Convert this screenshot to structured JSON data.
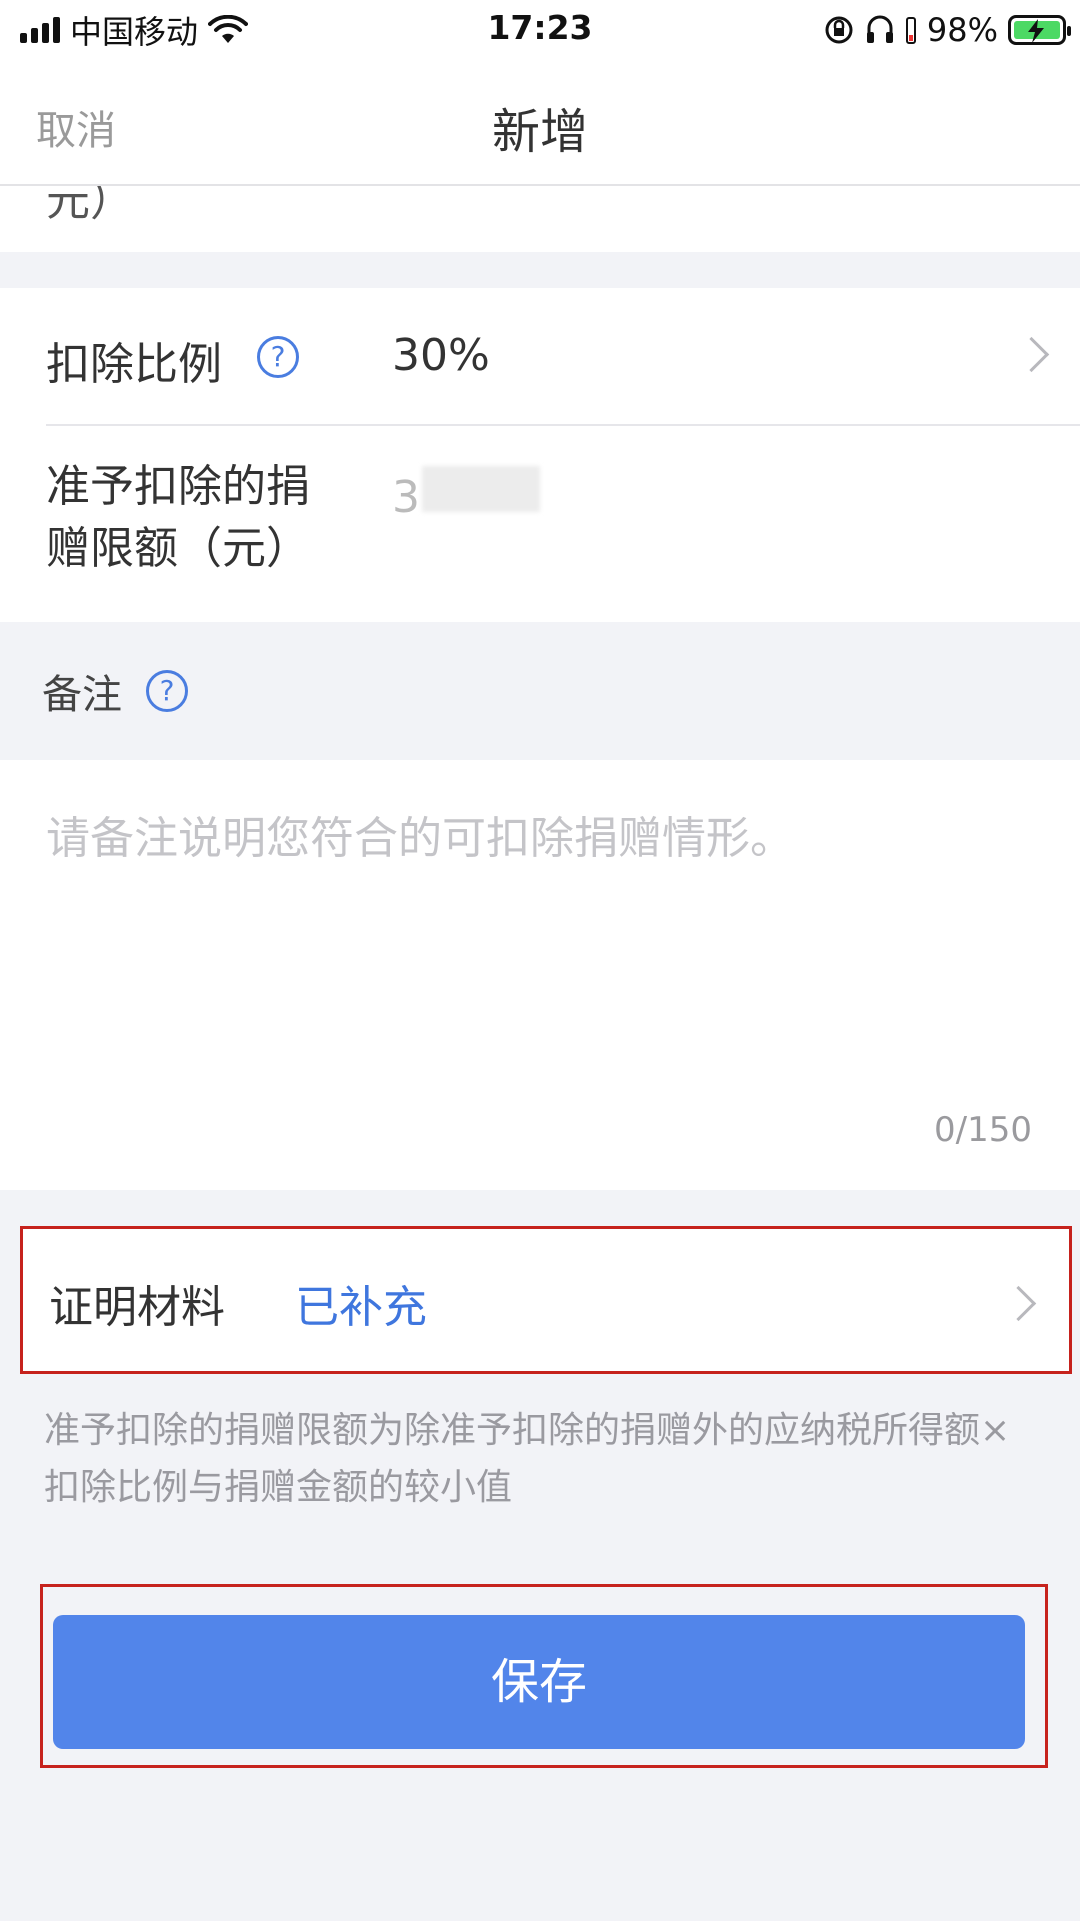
{
  "status_bar": {
    "carrier": "中国移动",
    "time": "17:23",
    "battery_percent": "98%"
  },
  "navbar": {
    "cancel_label": "取消",
    "title": "新增"
  },
  "partial_row_text": "元）",
  "deduction_ratio": {
    "label": "扣除比例",
    "value": "30%"
  },
  "deduction_limit": {
    "label_line1": "准予扣除的捐",
    "label_line2": "赠限额（元）",
    "value_visible": "3"
  },
  "remark": {
    "label": "备注",
    "placeholder": "请备注说明您符合的可扣除捐赠情形。",
    "counter": "0/150"
  },
  "proof_materials": {
    "label": "证明材料",
    "value": "已补充",
    "value_color": "#3f76de"
  },
  "footnote": "准予扣除的捐赠限额为除准予扣除的捐赠外的应纳税所得额×扣除比例与捐赠金额的较小值",
  "save_button": {
    "label": "保存",
    "color": "#5285ea"
  },
  "highlight_color": "#c6221d"
}
